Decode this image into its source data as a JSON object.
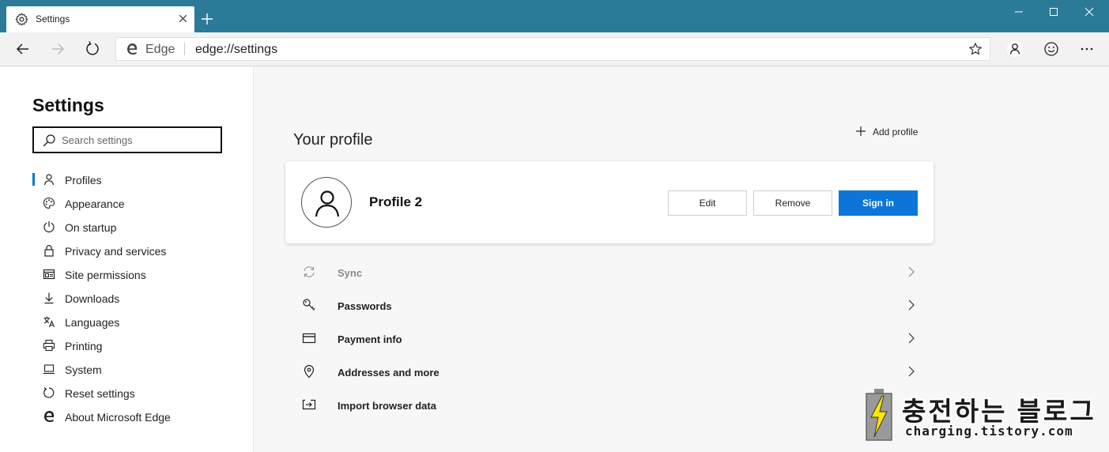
{
  "browser": {
    "tab": {
      "title": "Settings",
      "icon": "gear-icon"
    },
    "window_controls": [
      "minimize-icon",
      "maximize-icon",
      "close-icon"
    ],
    "address": {
      "site_label": "Edge",
      "url": "edge://settings"
    }
  },
  "sidebar": {
    "title": "Settings",
    "search_placeholder": "Search settings",
    "items": [
      {
        "label": "Profiles",
        "icon": "person-icon",
        "active": true
      },
      {
        "label": "Appearance",
        "icon": "palette-icon"
      },
      {
        "label": "On startup",
        "icon": "power-icon"
      },
      {
        "label": "Privacy and services",
        "icon": "lock-icon"
      },
      {
        "label": "Site permissions",
        "icon": "site-permissions-icon"
      },
      {
        "label": "Downloads",
        "icon": "download-icon"
      },
      {
        "label": "Languages",
        "icon": "languages-icon"
      },
      {
        "label": "Printing",
        "icon": "printer-icon"
      },
      {
        "label": "System",
        "icon": "laptop-icon"
      },
      {
        "label": "Reset settings",
        "icon": "reset-icon"
      },
      {
        "label": "About Microsoft Edge",
        "icon": "edge-logo-icon"
      }
    ]
  },
  "main": {
    "section_title": "Your profile",
    "add_profile_label": "Add profile",
    "profile": {
      "name": "Profile 2",
      "edit_label": "Edit",
      "remove_label": "Remove",
      "signin_label": "Sign in"
    },
    "rows": [
      {
        "label": "Sync",
        "icon": "sync-icon",
        "disabled": true
      },
      {
        "label": "Passwords",
        "icon": "key-icon"
      },
      {
        "label": "Payment info",
        "icon": "card-icon"
      },
      {
        "label": "Addresses and more",
        "icon": "location-pin-icon"
      },
      {
        "label": "Import browser data",
        "icon": "import-icon"
      }
    ]
  },
  "watermark": {
    "title": "충전하는 블로그",
    "subtitle": "charging.tistory.com"
  },
  "colors": {
    "titlebar": "#2b7b98",
    "accent": "#0b76d8",
    "sidebar_bg": "#ffffff",
    "content_bg": "#f7f7f7"
  }
}
